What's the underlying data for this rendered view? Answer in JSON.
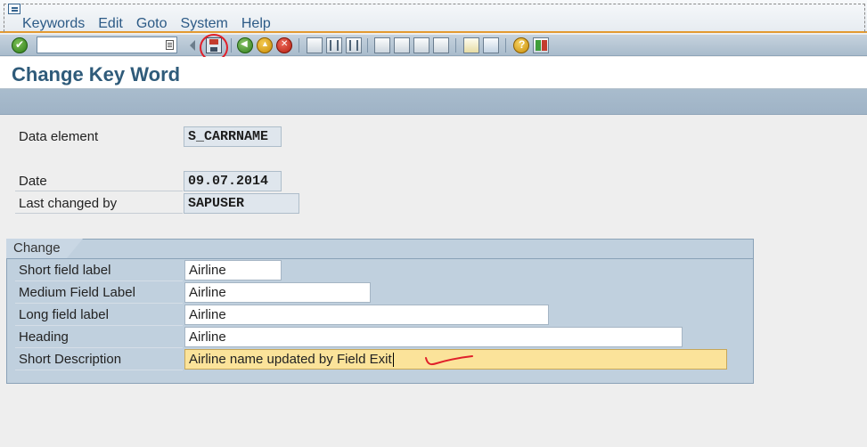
{
  "menu": {
    "items": [
      "Keywords",
      "Edit",
      "Goto",
      "System",
      "Help"
    ]
  },
  "toolbar": {
    "command_field_value": "",
    "icons": [
      "enter-icon",
      "command-history-icon",
      "previous-icon",
      "save-icon",
      "back-icon",
      "exit-icon",
      "cancel-icon",
      "print-icon",
      "find-icon",
      "find-next-icon",
      "first-page-icon",
      "previous-page-icon",
      "next-page-icon",
      "last-page-icon",
      "new-session-icon",
      "create-shortcut-icon",
      "help-icon",
      "customize-layout-icon"
    ]
  },
  "page": {
    "title": "Change Key Word"
  },
  "header_fields": {
    "data_element_label": "Data element",
    "data_element_value": "S_CARRNAME",
    "date_label": "Date",
    "date_value": "09.07.2014",
    "last_changed_by_label": "Last changed by",
    "last_changed_by_value": "SAPUSER"
  },
  "change": {
    "group_title": "Change",
    "short_label": "Short field label",
    "short_value": "Airline",
    "medium_label": "Medium Field Label",
    "medium_value": "Airline",
    "long_label": "Long field label",
    "long_value": "Airline",
    "heading_label": "Heading",
    "heading_value": "Airline",
    "description_label": "Short Description",
    "description_value": "Airline name updated by Field Exit"
  },
  "colors": {
    "accent": "#e39a32",
    "title_text": "#2f5b7a",
    "focused_field": "#fbe39a",
    "annotation": "#e0202a"
  }
}
